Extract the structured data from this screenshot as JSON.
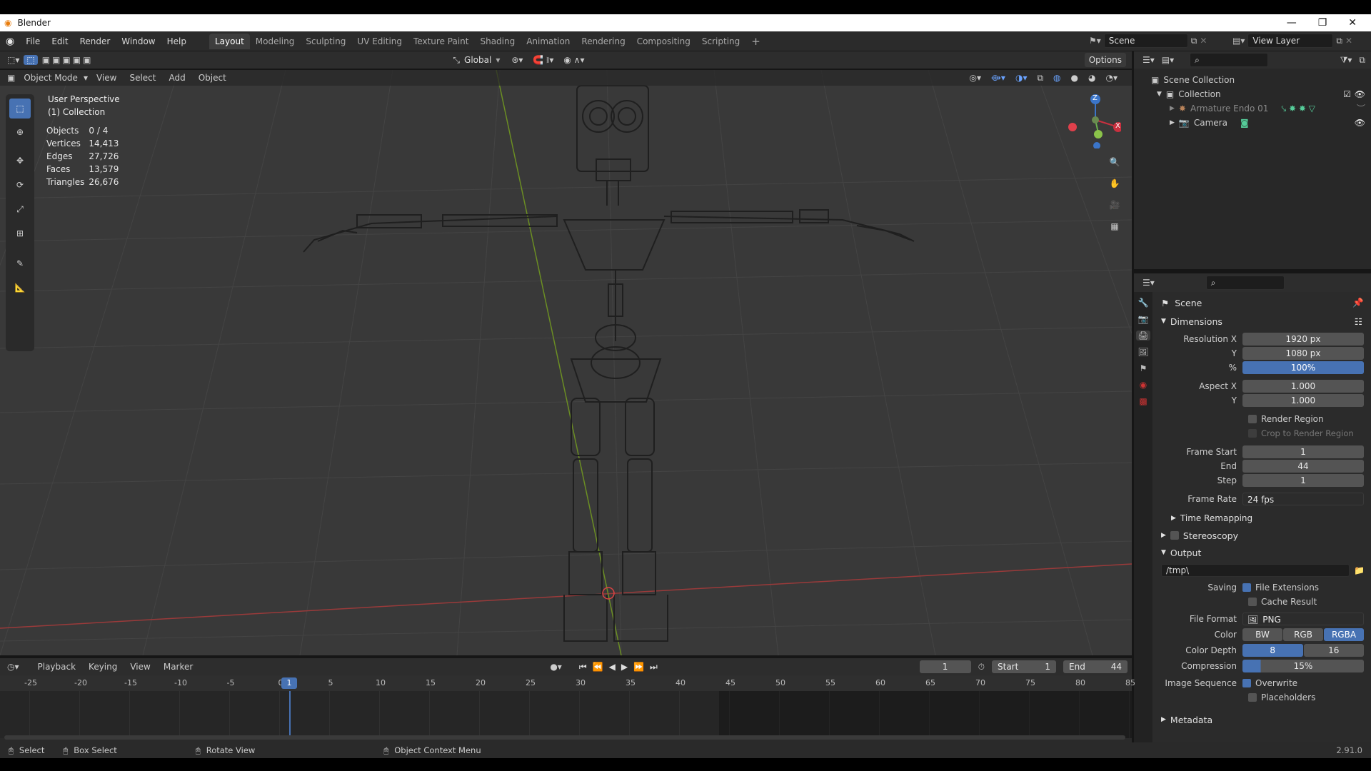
{
  "titlebar": {
    "app_title": "Blender"
  },
  "menu": [
    "File",
    "Edit",
    "Render",
    "Window",
    "Help"
  ],
  "workspaces": [
    "Layout",
    "Modeling",
    "Sculpting",
    "UV Editing",
    "Texture Paint",
    "Shading",
    "Animation",
    "Rendering",
    "Compositing",
    "Scripting"
  ],
  "active_workspace": "Layout",
  "top_right": {
    "scene": "Scene",
    "view_layer": "View Layer"
  },
  "viewport_header": {
    "mode": "Object Mode",
    "menus": [
      "View",
      "Select",
      "Add",
      "Object"
    ],
    "orientation": "Global",
    "options": "Options"
  },
  "overlay_text": {
    "perspective": "User Perspective",
    "collection": "(1) Collection"
  },
  "stats": [
    {
      "label": "Objects",
      "value": "0 / 4"
    },
    {
      "label": "Vertices",
      "value": "14,413"
    },
    {
      "label": "Edges",
      "value": "27,726"
    },
    {
      "label": "Faces",
      "value": "13,579"
    },
    {
      "label": "Triangles",
      "value": "26,676"
    }
  ],
  "gizmo": {
    "z": "Z",
    "x": "X"
  },
  "outliner": {
    "root": "Scene Collection",
    "collection": "Collection",
    "items": [
      "Armature Endo 01",
      "Camera"
    ]
  },
  "properties": {
    "context": "Scene",
    "dimensions": {
      "title": "Dimensions",
      "resolution_x_label": "Resolution X",
      "resolution_x": "1920 px",
      "resolution_y_label": "Y",
      "resolution_y": "1080 px",
      "percent_label": "%",
      "percent": "100%",
      "aspect_x_label": "Aspect X",
      "aspect_x": "1.000",
      "aspect_y_label": "Y",
      "aspect_y": "1.000",
      "render_region": "Render Region",
      "crop_region": "Crop to Render Region",
      "frame_start_label": "Frame Start",
      "frame_start": "1",
      "end_label": "End",
      "end": "44",
      "step_label": "Step",
      "step": "1",
      "frame_rate_label": "Frame Rate",
      "frame_rate": "24 fps",
      "time_remapping": "Time Remapping"
    },
    "stereoscopy": "Stereoscopy",
    "output": {
      "title": "Output",
      "path": "/tmp\\",
      "saving_label": "Saving",
      "file_extensions": "File Extensions",
      "cache_result": "Cache Result",
      "file_format_label": "File Format",
      "file_format": "PNG",
      "color_label": "Color",
      "color_options": [
        "BW",
        "RGB",
        "RGBA"
      ],
      "color_selected": "RGBA",
      "color_depth_label": "Color Depth",
      "depth_options": [
        "8",
        "16"
      ],
      "depth_selected": "8",
      "compression_label": "Compression",
      "compression": "15%",
      "image_sequence_label": "Image Sequence",
      "overwrite": "Overwrite",
      "placeholders": "Placeholders"
    },
    "metadata": "Metadata"
  },
  "timeline": {
    "menus": [
      "Playback",
      "Keying",
      "View",
      "Marker"
    ],
    "current_frame": "1",
    "start_label": "Start",
    "start": "1",
    "end_label": "End",
    "end": "44",
    "ticks": [
      "-25",
      "-20",
      "-15",
      "-10",
      "-5",
      "0",
      "5",
      "10",
      "15",
      "20",
      "25",
      "30",
      "35",
      "40",
      "45",
      "50",
      "55",
      "60",
      "65",
      "70",
      "75",
      "80",
      "85"
    ],
    "playhead": "1"
  },
  "statusbar": {
    "select": "Select",
    "box_select": "Box Select",
    "rotate_view": "Rotate View",
    "context_menu": "Object Context Menu",
    "version": "2.91.0"
  }
}
